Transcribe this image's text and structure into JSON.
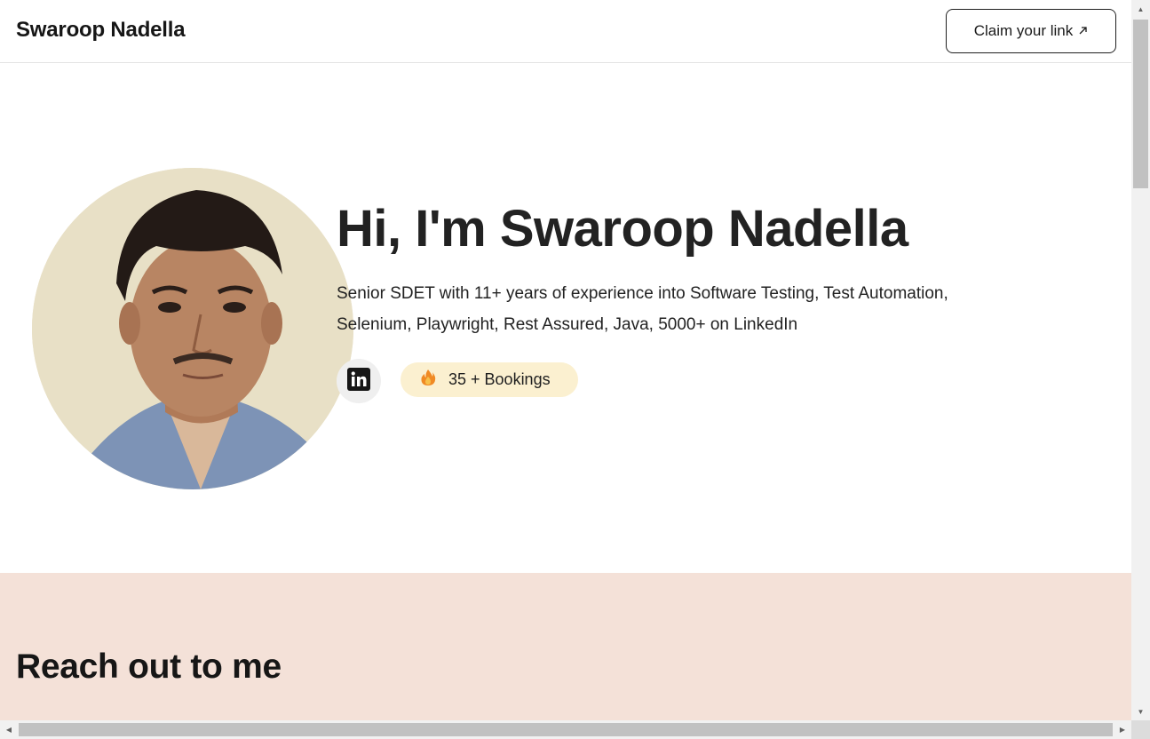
{
  "header": {
    "brand": "Swaroop Nadella",
    "claim_label": "Claim your link",
    "claim_icon": "arrow-up-right-icon"
  },
  "hero": {
    "title": "Hi, I'm Swaroop Nadella",
    "description": "Senior SDET with 11+ years of experience into Software Testing, Test Automation, Selenium, Playwright, Rest Assured, Java, 5000+ on LinkedIn",
    "linkedin_icon": "linkedin-icon",
    "bookings_label": "35 + Bookings",
    "bookings_icon": "fire-icon",
    "colors": {
      "avatar_bg": "#e8e0c6",
      "bookings_bg": "#fbf0d0"
    }
  },
  "reach": {
    "title": "Reach out to me",
    "bg": "#f4e1d8"
  }
}
